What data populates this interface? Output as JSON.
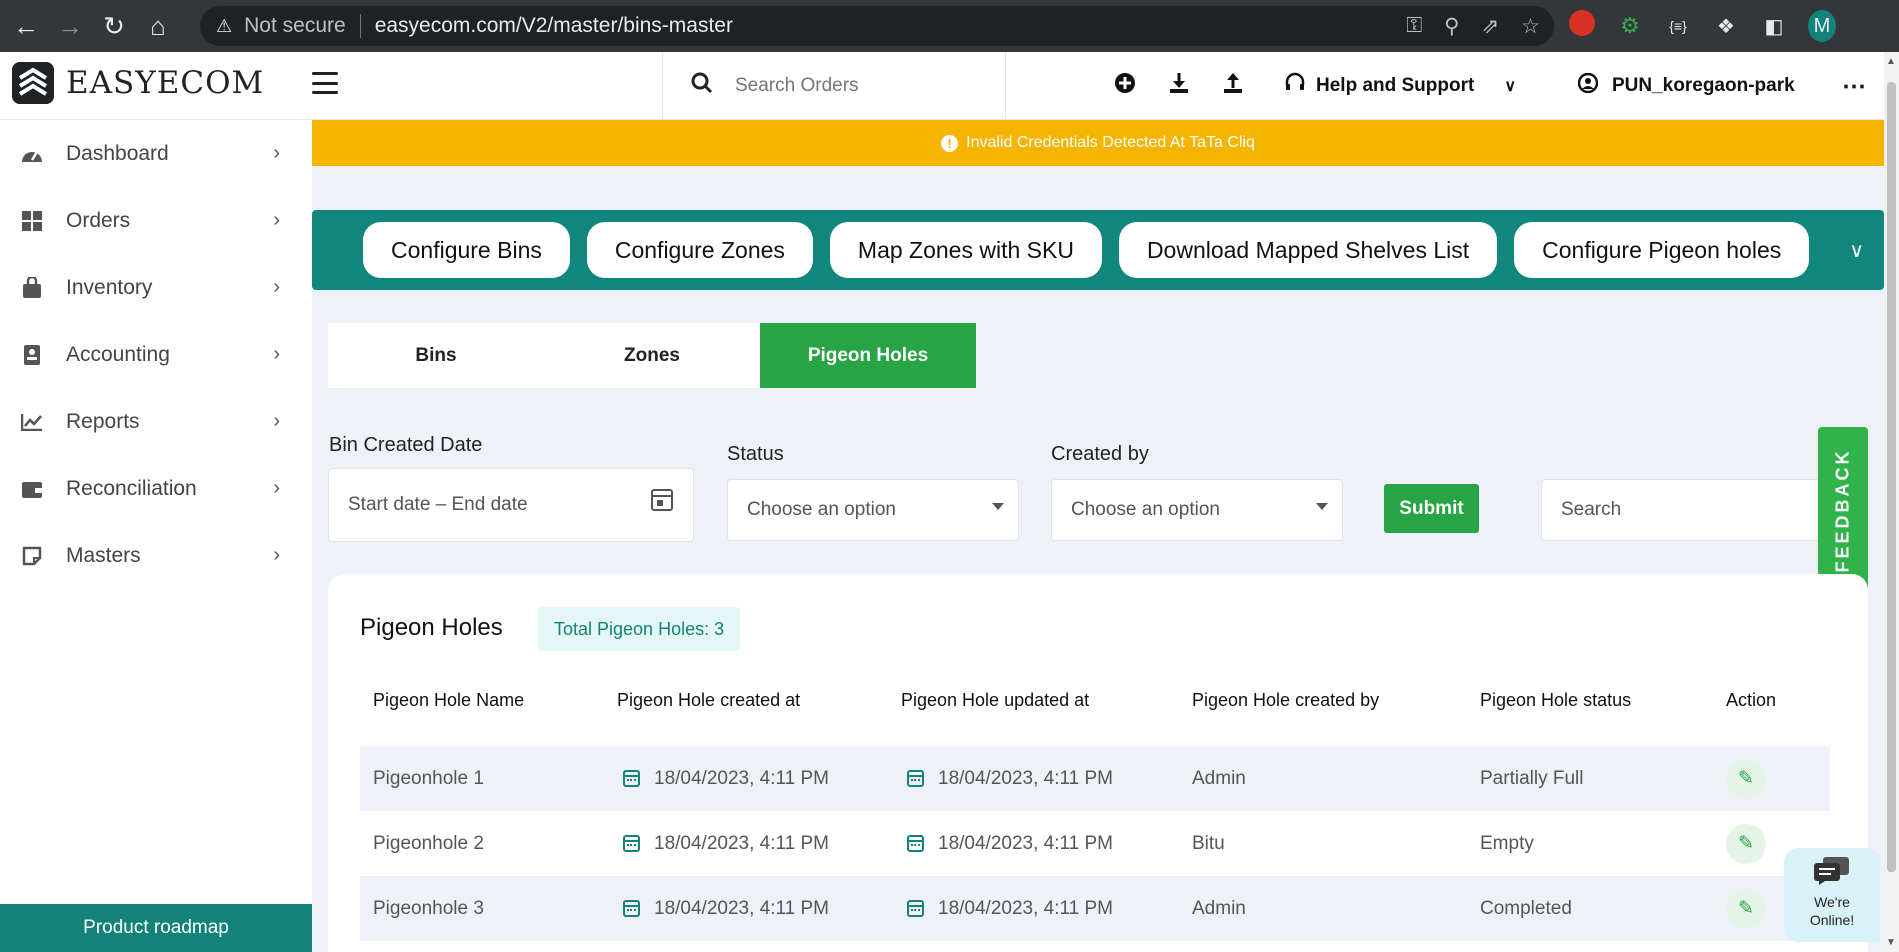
{
  "browser": {
    "security_label": "Not secure",
    "url": "easyecom.com/V2/master/bins-master",
    "profile_initial": "M"
  },
  "header": {
    "brand": "EASYECOM",
    "search_placeholder": "Search Orders",
    "help_label": "Help and Support",
    "user_label": "PUN_koregaon-park"
  },
  "sidebar": {
    "items": [
      {
        "label": "Dashboard",
        "icon": "dashboard-icon"
      },
      {
        "label": "Orders",
        "icon": "orders-grid-icon"
      },
      {
        "label": "Inventory",
        "icon": "bag-icon"
      },
      {
        "label": "Accounting",
        "icon": "ledger-icon"
      },
      {
        "label": "Reports",
        "icon": "chart-icon"
      },
      {
        "label": "Reconciliation",
        "icon": "wallet-icon"
      },
      {
        "label": "Masters",
        "icon": "note-icon"
      }
    ],
    "roadmap_label": "Product roadmap"
  },
  "banner": {
    "text": "Invalid Credentials Detected At TaTa Cliq",
    "color": "#f4b400"
  },
  "config_buttons": [
    "Configure Bins",
    "Configure Zones",
    "Map Zones with SKU",
    "Download Mapped Shelves List",
    "Configure Pigeon holes"
  ],
  "tabs": [
    {
      "label": "Bins",
      "active": false
    },
    {
      "label": "Zones",
      "active": false
    },
    {
      "label": "Pigeon Holes",
      "active": true
    }
  ],
  "filters": {
    "date_label": "Bin Created Date",
    "date_placeholder": "Start date – End date",
    "status_label": "Status",
    "status_value": "Choose an option",
    "created_by_label": "Created by",
    "created_by_value": "Choose an option",
    "submit_label": "Submit",
    "search_placeholder": "Search"
  },
  "feedback_label": "FEEDBACK",
  "table": {
    "title": "Pigeon Holes",
    "total_badge": "Total Pigeon Holes: 3",
    "columns": [
      "Pigeon Hole Name",
      "Pigeon Hole created at",
      "Pigeon Hole updated at",
      "Pigeon Hole created by",
      "Pigeon Hole status",
      "Action"
    ],
    "rows": [
      {
        "name": "Pigeonhole 1",
        "created_at": "18/04/2023, 4:11 PM",
        "updated_at": "18/04/2023, 4:11 PM",
        "created_by": "Admin",
        "status": "Partially Full"
      },
      {
        "name": "Pigeonhole 2",
        "created_at": "18/04/2023, 4:11 PM",
        "updated_at": "18/04/2023, 4:11 PM",
        "created_by": "Bitu",
        "status": "Empty"
      },
      {
        "name": "Pigeonhole 3",
        "created_at": "18/04/2023, 4:11 PM",
        "updated_at": "18/04/2023, 4:11 PM",
        "created_by": "Admin",
        "status": "Completed"
      }
    ]
  },
  "chat": {
    "line1": "We're",
    "line2": "Online!"
  },
  "colors": {
    "teal": "#11867d",
    "green": "#27a544",
    "banner": "#f4b400"
  }
}
